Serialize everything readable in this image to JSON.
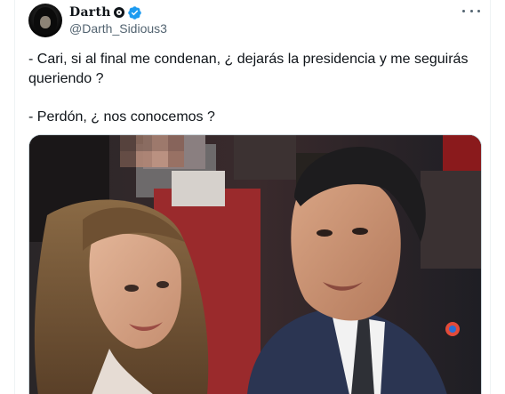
{
  "author": {
    "display_name": "Darth",
    "handle": "@Darth_Sidious3",
    "verified": true,
    "avatar_icon": "hooded-figure-avatar"
  },
  "tweet": {
    "lines": [
      "- Cari, si al final me condenan, ¿ dejarás la presidencia y me seguirás queriendo ?",
      "- Perdón, ¿ nos conocemos ?"
    ],
    "media_description_icon": "photo-couple-at-event"
  },
  "colors": {
    "text": "#0f1419",
    "secondary": "#536471",
    "verified": "#1d9bf0",
    "border": "#cfd9de"
  }
}
